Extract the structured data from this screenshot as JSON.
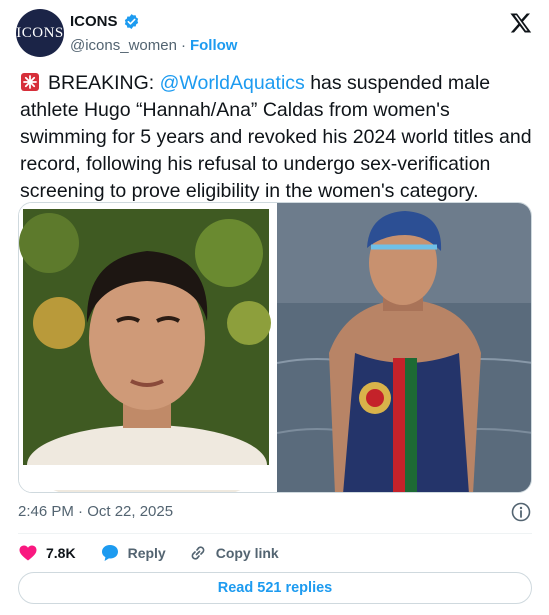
{
  "account": {
    "avatar_text": "ICONS",
    "name": "ICONS",
    "handle": "@icons_women",
    "separator": "·",
    "follow_label": "Follow"
  },
  "tweet": {
    "prefix": "BREAKING: ",
    "mention": "@WorldAquatics",
    "body": " has suspended male athlete Hugo “Hannah/Ana” Caldas from women's swimming for 5 years and revoked his 2024 world titles and record, following his refusal to undergo sex-verification screening to prove eligibility in the women's category."
  },
  "media": {
    "left_photo": "portrait-photo",
    "right_photo": "swimmer-photo"
  },
  "meta": {
    "timestamp": "2:46 PM · Oct 22, 2025"
  },
  "actions": {
    "like_count": "7.8K",
    "reply_label": "Reply",
    "copy_label": "Copy link"
  },
  "read_replies_label": "Read 521 replies",
  "colors": {
    "accent": "#1d9bf0",
    "like": "#f91880",
    "text": "#0f1419",
    "muted": "#536471",
    "border": "#cfd9de"
  }
}
